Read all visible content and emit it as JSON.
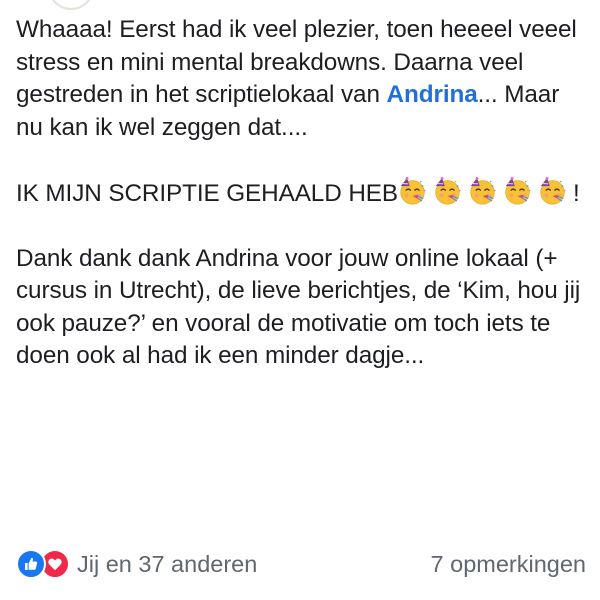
{
  "post": {
    "paragraph1": {
      "before_mention": "Whaaaa! Eerst had ik veel plezier, toen heeeel veeel stress en mini mental breakdowns. Daarna veel gestreden in het scriptielokaal van ",
      "mention": "Andrina",
      "after_mention": "... Maar nu kan ik wel zeggen dat...."
    },
    "paragraph2": {
      "text": "IK MIJN SCRIPTIE GEHAALD HEB",
      "emoji_name": "partying-face",
      "emoji_count": 5,
      "trailing": "!"
    },
    "paragraph3": {
      "text": "Dank dank dank Andrina voor jouw online lokaal (+ cursus in Utrecht), de lieve berichtjes, de ‘Kim, hou jij ook pauze?’ en vooral de motivatie om toch iets te doen ook al had ik een minder dagje..."
    }
  },
  "footer": {
    "reactions_text": "Jij en 37 anderen",
    "comments_text": "7 opmerkingen",
    "reaction_icons": [
      "like-icon",
      "love-icon"
    ]
  },
  "colors": {
    "mention": "#216fdb",
    "like": "#1877f2",
    "love": "#f02849",
    "secondary_text": "#606770"
  }
}
